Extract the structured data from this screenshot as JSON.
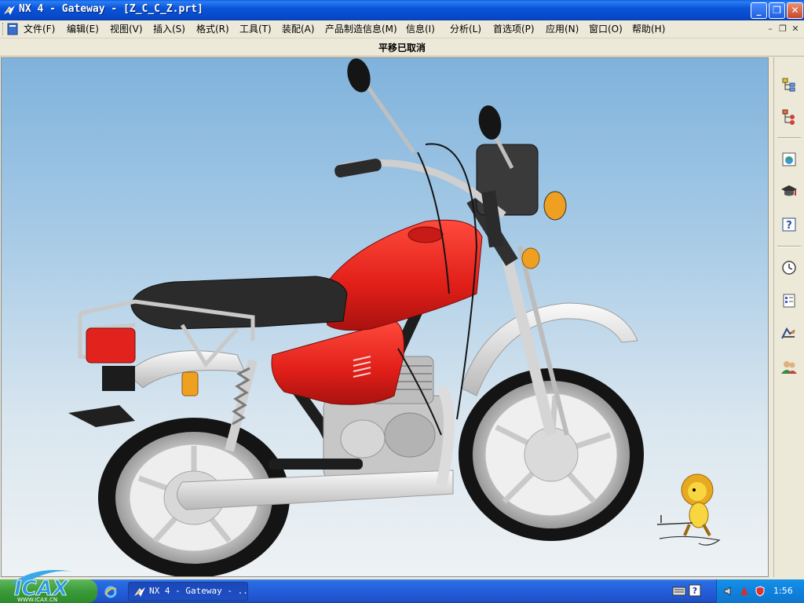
{
  "window": {
    "title": "NX 4 - Gateway - [Z_C_C_Z.prt]"
  },
  "menu": {
    "items": [
      "文件(F)",
      "编辑(E)",
      "视图(V)",
      "插入(S)",
      "格式(R)",
      "工具(T)",
      "装配(A)",
      "产品制造信息(M)",
      "信息(I)",
      "分析(L)",
      "首选项(P)",
      "应用(N)",
      "窗口(O)",
      "帮助(H)"
    ]
  },
  "cue": {
    "text": "平移已取消"
  },
  "viewport": {
    "model_label": "motorcycle-model"
  },
  "resource_bar": {
    "icons": [
      "assembly-navigator-icon",
      "part-navigator-icon",
      "web-browser-icon",
      "training-icon",
      "help-icon",
      "history-icon",
      "system-materials-icon",
      "process-studio-icon",
      "roles-icon"
    ]
  },
  "taskbar": {
    "task_label": "NX 4 - Gateway - ...",
    "clock": "1:56",
    "logo_text": "WWW.ICAX.CN"
  },
  "colors": {
    "title_blue": "#0a55d8",
    "tank_red": "#e52420",
    "seat_black": "#2a2a2a",
    "taskbar_blue": "#245edb"
  }
}
